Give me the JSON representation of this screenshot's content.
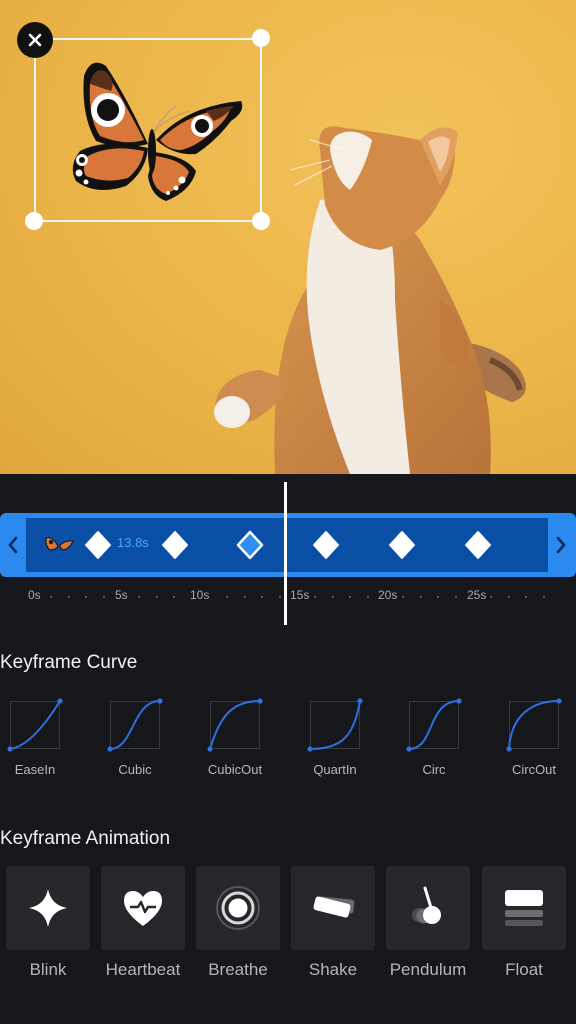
{
  "preview": {
    "sticker": {
      "name": "butterfly",
      "close_icon": "close-icon"
    }
  },
  "timeline": {
    "duration_label": "13.8s",
    "keyframes": [
      {
        "selected": false
      },
      {
        "selected": false
      },
      {
        "selected": true
      },
      {
        "selected": false
      },
      {
        "selected": false
      },
      {
        "selected": false
      }
    ],
    "ruler_labels": [
      "0s",
      "5s",
      "10s",
      "15s",
      "20s",
      "25s"
    ],
    "prev_icon": "chevron-left-icon",
    "next_icon": "chevron-right-icon",
    "colors": {
      "track": "#2b8af0",
      "track_inner": "#0a4fa6",
      "selected_keyframe": "#2e8ef5",
      "duration_text": "#4aa6ff"
    }
  },
  "keyframe_curve": {
    "title": "Keyframe Curve",
    "items": [
      {
        "label": "EaseIn",
        "curve": "easein"
      },
      {
        "label": "Cubic",
        "curve": "cubic"
      },
      {
        "label": "CubicOut",
        "curve": "cubicout"
      },
      {
        "label": "QuartIn",
        "curve": "quartin"
      },
      {
        "label": "Circ",
        "curve": "circ"
      },
      {
        "label": "CircOut",
        "curve": "circout"
      }
    ],
    "curve_color": "#2f6fe0"
  },
  "keyframe_animation": {
    "title": "Keyframe Animation",
    "items": [
      {
        "label": "Blink",
        "icon": "sparkle-icon"
      },
      {
        "label": "Heartbeat",
        "icon": "heartbeat-icon"
      },
      {
        "label": "Breathe",
        "icon": "breathe-icon"
      },
      {
        "label": "Shake",
        "icon": "shake-icon"
      },
      {
        "label": "Pendulum",
        "icon": "pendulum-icon"
      },
      {
        "label": "Float",
        "icon": "float-icon"
      }
    ]
  }
}
